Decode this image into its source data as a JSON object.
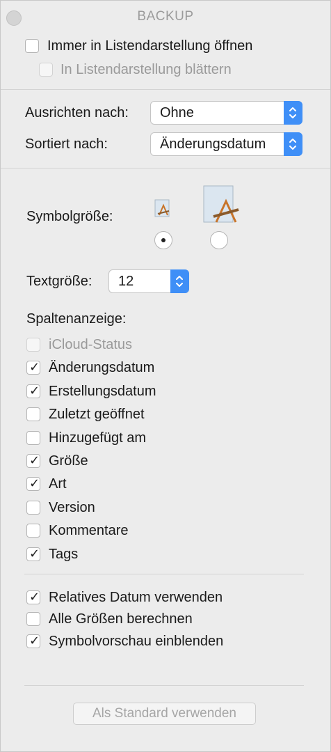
{
  "window": {
    "title": "BACKUP"
  },
  "options": {
    "always_list": {
      "label": "Immer in Listendarstellung öffnen",
      "checked": false
    },
    "browse_list": {
      "label": "In Listendarstellung blättern",
      "checked": false,
      "disabled": true
    }
  },
  "arrange": {
    "label": "Ausrichten nach:",
    "value": "Ohne"
  },
  "sort": {
    "label": "Sortiert nach:",
    "value": "Änderungsdatum"
  },
  "icon_size": {
    "label": "Symbolgröße:",
    "selected": "small"
  },
  "text_size": {
    "label": "Textgröße:",
    "value": "12"
  },
  "columns": {
    "label": "Spaltenanzeige:",
    "items": [
      {
        "label": "iCloud-Status",
        "checked": false,
        "disabled": true
      },
      {
        "label": "Änderungsdatum",
        "checked": true
      },
      {
        "label": "Erstellungsdatum",
        "checked": true
      },
      {
        "label": "Zuletzt geöffnet",
        "checked": false
      },
      {
        "label": "Hinzugefügt am",
        "checked": false
      },
      {
        "label": "Größe",
        "checked": true
      },
      {
        "label": "Art",
        "checked": true
      },
      {
        "label": "Version",
        "checked": false
      },
      {
        "label": "Kommentare",
        "checked": false
      },
      {
        "label": "Tags",
        "checked": true
      }
    ]
  },
  "extra": {
    "items": [
      {
        "label": "Relatives Datum verwenden",
        "checked": true
      },
      {
        "label": "Alle Größen berechnen",
        "checked": false
      },
      {
        "label": "Symbolvorschau einblenden",
        "checked": true
      }
    ]
  },
  "default_button": {
    "label": "Als Standard verwenden"
  },
  "colors": {
    "accent": "#3f8ff7",
    "window_bg": "#ececec",
    "disabled_text": "#9a9a9a"
  }
}
